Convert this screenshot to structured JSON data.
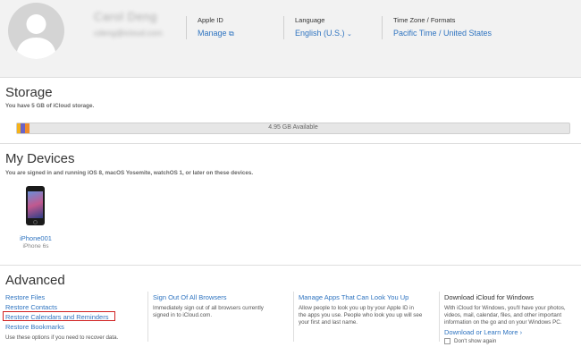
{
  "header": {
    "user_name": "Carol Deng",
    "user_email": "cdeng@icloud.com",
    "apple_id_label": "Apple ID",
    "apple_id_value": "Manage",
    "language_label": "Language",
    "language_value": "English (U.S.)",
    "timezone_label": "Time Zone / Formats",
    "timezone_value": "Pacific Time / United States"
  },
  "storage": {
    "title": "Storage",
    "subtitle": "You have 5 GB of iCloud storage.",
    "available": "4.95 GB Available",
    "colors": {
      "yellow": "#f5b31b",
      "purple": "#6a63c8",
      "orange": "#f08c2a",
      "track": "#e6e6e6"
    }
  },
  "devices": {
    "title": "My Devices",
    "subtitle": "You are signed in and running iOS 8, macOS Yosemite, watchOS 1, or later on these devices.",
    "items": [
      {
        "name": "iPhone001",
        "model": "iPhone 6s"
      }
    ]
  },
  "advanced": {
    "title": "Advanced",
    "restore_links": [
      "Restore Files",
      "Restore Contacts",
      "Restore Calendars and Reminders",
      "Restore Bookmarks"
    ],
    "restore_desc": "Use these options if you need to recover data.",
    "signout_title": "Sign Out Of All Browsers",
    "signout_desc": [
      "Immediately sign out of all browsers currently",
      "signed in to iCloud.com."
    ],
    "manage_apps_title": "Manage Apps That Can Look You Up",
    "manage_apps_desc": [
      "Allow people to look you up by your Apple ID in",
      "the apps you use. People who look you up will see",
      "your first and last name."
    ],
    "windows_title": "Download iCloud for Windows",
    "windows_desc": [
      "With iCloud for Windows, you'll have your photos,",
      "videos, mail, calendar, files, and other important",
      "information on the go and on your Windows PC."
    ],
    "windows_link": "Download or Learn More",
    "dont_show": "Don't show again"
  },
  "accent": "#2f74c0",
  "highlight_color": "#d02020"
}
